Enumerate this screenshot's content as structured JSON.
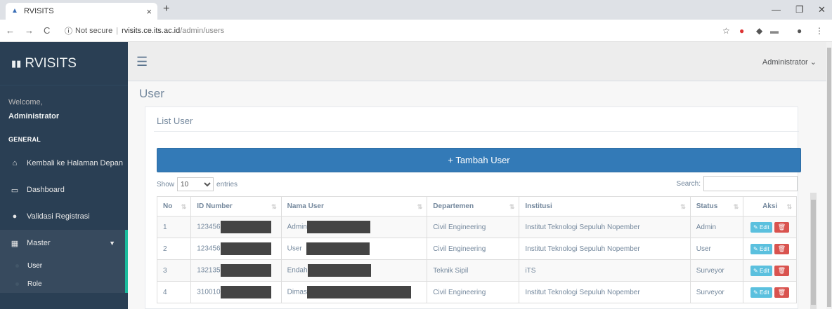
{
  "browser": {
    "tab_title": "RVISITS",
    "tab_close": "×",
    "new_tab": "+",
    "not_secure": "Not secure",
    "url_host": "rvisits.ce.its.ac.id",
    "url_path": "/admin/users"
  },
  "sidebar": {
    "brand": "RVISITS",
    "welcome": "Welcome,",
    "user": "Administrator",
    "section": "GENERAL",
    "items": [
      {
        "label": "Kembali ke Halaman Depan",
        "icon": "home-icon"
      },
      {
        "label": "Dashboard",
        "icon": "laptop-icon"
      },
      {
        "label": "Validasi Registrasi",
        "icon": "user-icon"
      },
      {
        "label": "Master",
        "icon": "windows-icon"
      }
    ],
    "submenu": [
      {
        "label": "User"
      },
      {
        "label": "Role"
      }
    ]
  },
  "topnav": {
    "user_menu": "Administrator ⌄"
  },
  "main": {
    "page_title": "User",
    "panel_title": "List User",
    "add_button": "+ Tambah User",
    "show_label": "Show",
    "entries_value": "10",
    "entries_label": "entries",
    "search_label": "Search:"
  },
  "table": {
    "headers": [
      "No",
      "ID Number",
      "Nama User",
      "Departemen",
      "Institusi",
      "Status",
      "Aksi"
    ],
    "rows": [
      {
        "no": "1",
        "id": "123456",
        "nama": "Admin",
        "dept": "Civil Engineering",
        "inst": "Institut Teknologi Sepuluh Nopember",
        "status": "Admin"
      },
      {
        "no": "2",
        "id": "123456",
        "nama": "User",
        "dept": "Civil Engineering",
        "inst": "Institut Teknologi Sepuluh Nopember",
        "status": "User"
      },
      {
        "no": "3",
        "id": "132135",
        "nama": "Endah",
        "dept": "Teknik Sipil",
        "inst": "iTS",
        "status": "Surveyor"
      },
      {
        "no": "4",
        "id": "310010",
        "nama": "Dimas",
        "dept": "Civil Engineering",
        "inst": "Institut Teknologi Sepuluh Nopember",
        "status": "Surveyor"
      }
    ],
    "edit_label": "Edit",
    "delete_icon": "trash-icon"
  }
}
